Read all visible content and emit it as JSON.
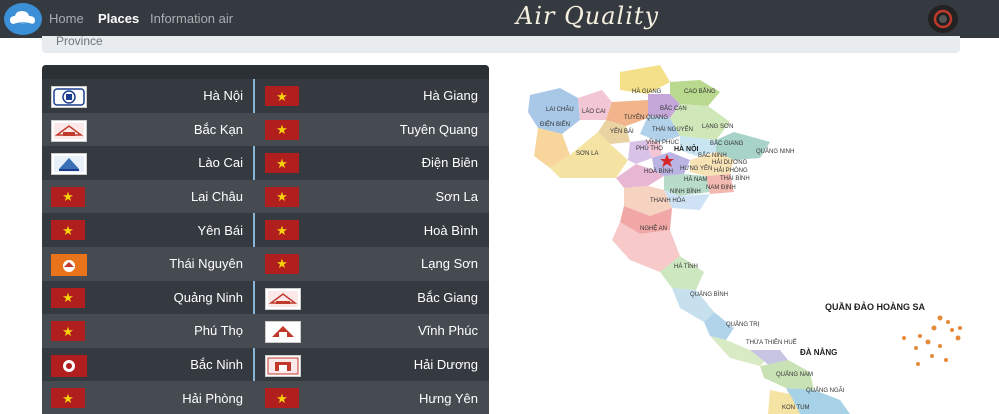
{
  "nav": {
    "home": "Home",
    "places": "Places",
    "info": "Information air",
    "brand": "Air Quality"
  },
  "province_label": "Province",
  "rows": [
    {
      "left": "Hà Nội",
      "right": "Hà Giang"
    },
    {
      "left": "Bắc Kạn",
      "right": "Tuyên Quang"
    },
    {
      "left": "Lào Cai",
      "right": "Điện Biên"
    },
    {
      "left": "Lai Châu",
      "right": "Sơn La"
    },
    {
      "left": "Yên Bái",
      "right": "Hoà Bình"
    },
    {
      "left": "Thái Nguyên",
      "right": "Lạng Sơn"
    },
    {
      "left": "Quảng Ninh",
      "right": "Bắc Giang"
    },
    {
      "left": "Phú Thọ",
      "right": "Vĩnh Phúc"
    },
    {
      "left": "Bắc Ninh",
      "right": "Hải Dương"
    },
    {
      "left": "Hải Phòng",
      "right": "Hưng Yên"
    }
  ],
  "map_labels": {
    "lai_chau": "LAI CHÂU",
    "lao_cai": "LÀO CAI",
    "ha_giang": "HÀ GIANG",
    "cao_bang": "CAO BẰNG",
    "bac_can": "BẮC CẠN",
    "dien_bien": "ĐIỆN BIÊN",
    "tuyen_quang": "TUYÊN QUANG",
    "yen_bai": "YÊN BÁI",
    "thai_nguyen": "THÁI NGUYÊN",
    "lang_son": "LẠNG SƠN",
    "vinh_phuc": "VĨNH PHÚC",
    "son_la": "SƠN LA",
    "phu_tho": "PHÚ THỌ",
    "ha_noi": "HÀ NỘI",
    "bac_giang": "BẮC GIANG",
    "bac_ninh": "BẮC NINH",
    "quang_ninh": "QUẢNG NINH",
    "hai_duong": "HẢI DƯƠNG",
    "hai_phong": "HẢI PHÒNG",
    "hoa_binh": "HOÀ BÌNH",
    "hung_yen": "HƯNG YÊN",
    "thai_binh": "THÁI BÌNH",
    "ha_nam": "HÀ NAM",
    "nam_dinh": "NAM ĐỊNH",
    "ninh_binh": "NINH BÌNH",
    "thanh_hoa": "THANH HÓA",
    "nghe_an": "NGHỆ AN",
    "ha_tinh": "HÀ TĨNH",
    "quang_binh": "QUẢNG BÌNH",
    "quang_tri": "QUẢNG TRỊ",
    "thua_thien_hue": "THỪA THIÊN HUẾ",
    "da_nang": "ĐÀ NẴNG",
    "quang_nam": "QUẢNG NAM",
    "quang_ngai": "QUẢNG NGÃI",
    "kon_tum": "KON TUM",
    "hoang_sa": "QUẦN ĐẢO HOÀNG SA"
  },
  "colors": {
    "navbar": "#353a40",
    "row_alt": "#454b51",
    "divider": "#89b6d6",
    "flag_red": "#b01e1e",
    "flag_star": "#f5d20a"
  },
  "icons": {
    "logo": "cloud-logo-icon",
    "settings": "settings-icon",
    "capital_star": "star-icon"
  }
}
